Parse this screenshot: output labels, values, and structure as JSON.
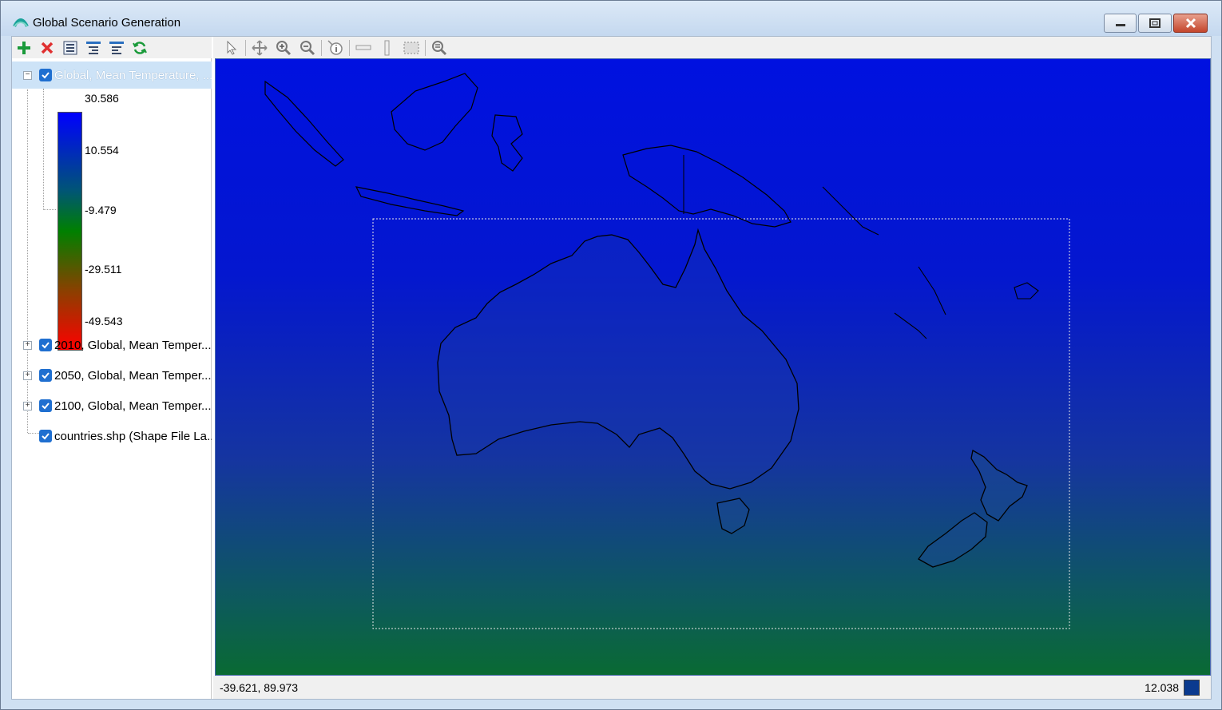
{
  "window": {
    "title": "Global Scenario Generation"
  },
  "left_toolbar": {
    "icons": [
      "add-icon",
      "delete-icon",
      "list-icon",
      "collapse-all-icon",
      "expand-all-icon",
      "refresh-icon"
    ]
  },
  "layers": [
    {
      "label": "Global, Mean Temperature, ...",
      "checked": true,
      "expanded": true,
      "selected": true
    },
    {
      "label": "2010, Global, Mean Temper...",
      "checked": true,
      "expanded": false
    },
    {
      "label": "2050, Global, Mean Temper...",
      "checked": true,
      "expanded": false
    },
    {
      "label": "2100, Global, Mean Temper...",
      "checked": true,
      "expanded": false
    },
    {
      "label": "countries.shp (Shape File La...",
      "checked": true
    }
  ],
  "legend": {
    "labels": [
      "30.586",
      "10.554",
      "-9.479",
      "-29.511",
      "-49.543"
    ],
    "colors": [
      "#0000ff",
      "#008000",
      "#ff0000"
    ]
  },
  "map_toolbar": {
    "icons": [
      "select-arrow-icon",
      "pan-icon",
      "zoom-in-icon",
      "zoom-out-icon",
      "identify-icon",
      "horizontal-measure-icon",
      "vertical-measure-icon",
      "select-region-icon",
      "zoom-extent-icon"
    ]
  },
  "status": {
    "coordinates": "-39.621, 89.973",
    "value": "12.038",
    "value_color": "#0a3a8f"
  }
}
